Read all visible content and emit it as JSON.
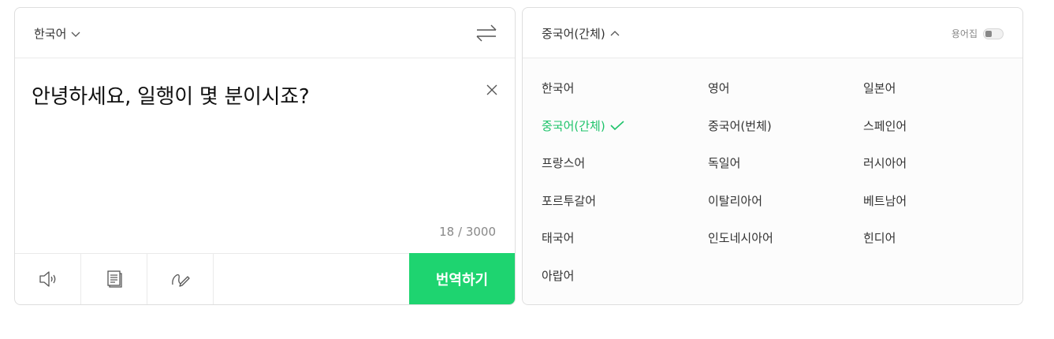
{
  "source": {
    "language": "한국어",
    "text": "안녕하세요, 일행이 몇 분이시죠?",
    "char_count": "18",
    "char_limit": "3000",
    "count_separator": " / "
  },
  "target": {
    "language": "중국어(간체)",
    "glossary_label": "용어집"
  },
  "toolbar": {
    "translate_label": "번역하기"
  },
  "languages": [
    {
      "label": "한국어",
      "selected": false
    },
    {
      "label": "영어",
      "selected": false
    },
    {
      "label": "일본어",
      "selected": false
    },
    {
      "label": "중국어(간체)",
      "selected": true
    },
    {
      "label": "중국어(번체)",
      "selected": false
    },
    {
      "label": "스페인어",
      "selected": false
    },
    {
      "label": "프랑스어",
      "selected": false
    },
    {
      "label": "독일어",
      "selected": false
    },
    {
      "label": "러시아어",
      "selected": false
    },
    {
      "label": "포르투갈어",
      "selected": false
    },
    {
      "label": "이탈리아어",
      "selected": false
    },
    {
      "label": "베트남어",
      "selected": false
    },
    {
      "label": "태국어",
      "selected": false
    },
    {
      "label": "인도네시아어",
      "selected": false
    },
    {
      "label": "힌디어",
      "selected": false
    },
    {
      "label": "아랍어",
      "selected": false
    }
  ],
  "colors": {
    "accent": "#1ed470",
    "selected_text": "#1ec36a"
  }
}
